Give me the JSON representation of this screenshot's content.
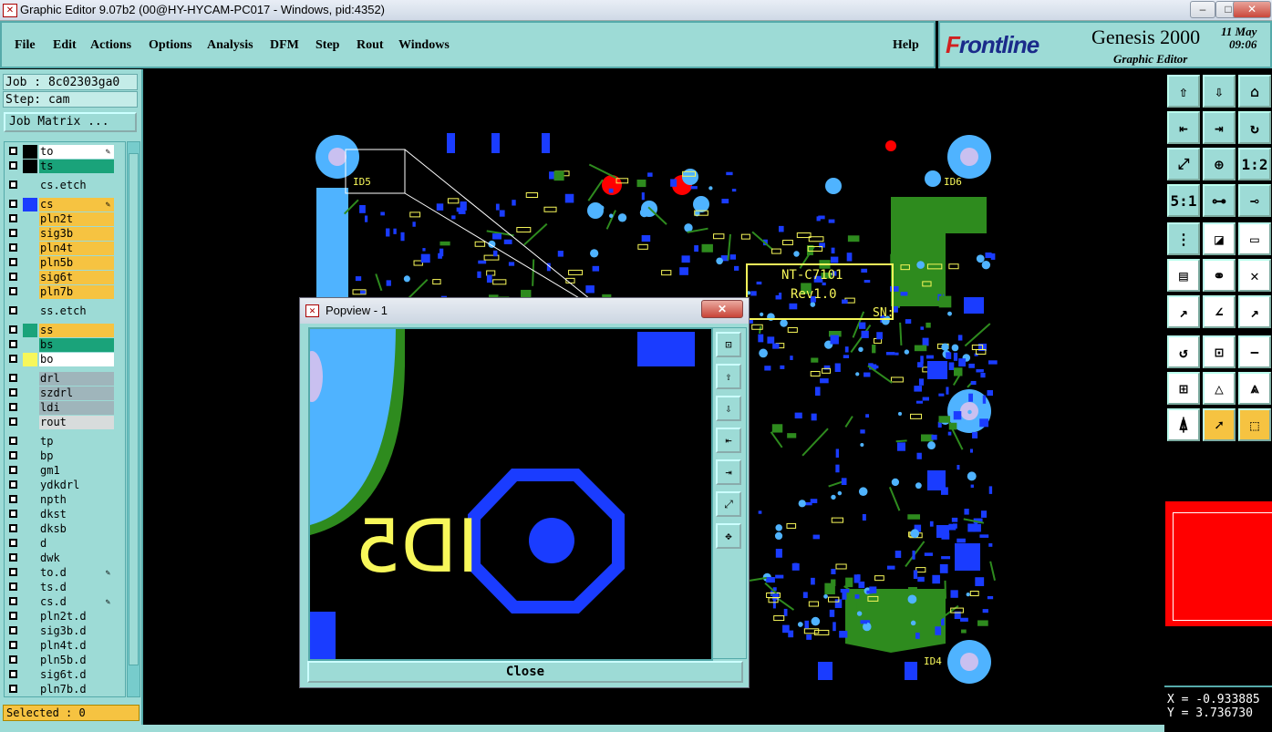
{
  "window": {
    "title": "Graphic Editor 9.07b2 (00@HY-HYCAM-PC017 - Windows, pid:4352)",
    "min": "–",
    "max": "□",
    "close": "✕"
  },
  "menubar": {
    "items": [
      "File",
      "Edit",
      "Actions",
      "Options",
      "Analysis",
      "DFM",
      "Step",
      "Rout",
      "Windows"
    ],
    "help": "Help"
  },
  "brand": {
    "logo_f": "F",
    "logo_rest": "rontline",
    "product": "Genesis 2000",
    "sub": "Graphic Editor",
    "date": "11 May",
    "time": "09:06"
  },
  "job": {
    "job_label": "Job : 8c02303ga0",
    "step_label": "Step: cam",
    "matrix_button": "Job Matrix ..."
  },
  "layers": [
    {
      "name": "to",
      "bg": "#ffffff",
      "swatch": "#000000",
      "edit": true
    },
    {
      "name": "ts",
      "bg": "#1aa37a",
      "swatch": "#000000",
      "edit": false
    },
    {
      "name": "cs.etch",
      "bg": "#9ddbd6",
      "swatch": "none",
      "edit": false
    },
    {
      "name": "cs",
      "bg": "#f6c341",
      "swatch": "#1a3cff",
      "edit": true
    },
    {
      "name": "pln2t",
      "bg": "#f6c341",
      "swatch": "none",
      "edit": false
    },
    {
      "name": "sig3b",
      "bg": "#f6c341",
      "swatch": "none",
      "edit": false
    },
    {
      "name": "pln4t",
      "bg": "#f6c341",
      "swatch": "none",
      "edit": false
    },
    {
      "name": "pln5b",
      "bg": "#f6c341",
      "swatch": "none",
      "edit": false
    },
    {
      "name": "sig6t",
      "bg": "#f6c341",
      "swatch": "none",
      "edit": false
    },
    {
      "name": "pln7b",
      "bg": "#f6c341",
      "swatch": "none",
      "edit": false
    },
    {
      "name": "ss.etch",
      "bg": "#9ddbd6",
      "swatch": "none",
      "edit": false
    },
    {
      "name": "ss",
      "bg": "#f6c341",
      "swatch": "#1aa37a",
      "edit": false
    },
    {
      "name": "bs",
      "bg": "#1aa37a",
      "swatch": "none",
      "edit": false
    },
    {
      "name": "bo",
      "bg": "#ffffff",
      "swatch": "#f7f75a",
      "edit": false
    },
    {
      "name": "drl",
      "bg": "#9fb5bb",
      "swatch": "none",
      "edit": false
    },
    {
      "name": "szdrl",
      "bg": "#9fb5bb",
      "swatch": "none",
      "edit": false
    },
    {
      "name": "ldi",
      "bg": "#9fb5bb",
      "swatch": "none",
      "edit": false
    },
    {
      "name": "rout",
      "bg": "#d8dcdc",
      "swatch": "none",
      "edit": false
    },
    {
      "name": "tp",
      "bg": "#9ddbd6",
      "swatch": "none",
      "edit": false
    },
    {
      "name": "bp",
      "bg": "#9ddbd6",
      "swatch": "none",
      "edit": false
    },
    {
      "name": "gm1",
      "bg": "#9ddbd6",
      "swatch": "none",
      "edit": false
    },
    {
      "name": "ydkdrl",
      "bg": "#9ddbd6",
      "swatch": "none",
      "edit": false
    },
    {
      "name": "npth",
      "bg": "#9ddbd6",
      "swatch": "none",
      "edit": false
    },
    {
      "name": "dkst",
      "bg": "#9ddbd6",
      "swatch": "none",
      "edit": false
    },
    {
      "name": "dksb",
      "bg": "#9ddbd6",
      "swatch": "none",
      "edit": false
    },
    {
      "name": "d",
      "bg": "#9ddbd6",
      "swatch": "none",
      "edit": false
    },
    {
      "name": "dwk",
      "bg": "#9ddbd6",
      "swatch": "none",
      "edit": false
    },
    {
      "name": "to.d",
      "bg": "#9ddbd6",
      "swatch": "none",
      "edit": true
    },
    {
      "name": "ts.d",
      "bg": "#9ddbd6",
      "swatch": "none",
      "edit": false
    },
    {
      "name": "cs.d",
      "bg": "#9ddbd6",
      "swatch": "none",
      "edit": true
    },
    {
      "name": "pln2t.d",
      "bg": "#9ddbd6",
      "swatch": "none",
      "edit": false
    },
    {
      "name": "sig3b.d",
      "bg": "#9ddbd6",
      "swatch": "none",
      "edit": false
    },
    {
      "name": "pln4t.d",
      "bg": "#9ddbd6",
      "swatch": "none",
      "edit": false
    },
    {
      "name": "pln5b.d",
      "bg": "#9ddbd6",
      "swatch": "none",
      "edit": false
    },
    {
      "name": "sig6t.d",
      "bg": "#9ddbd6",
      "swatch": "none",
      "edit": false
    },
    {
      "name": "pln7b.d",
      "bg": "#9ddbd6",
      "swatch": "none",
      "edit": false
    }
  ],
  "status": {
    "selected": "Selected : 0"
  },
  "board": {
    "silk_texts": [
      "NT-C7101",
      "Rev1.0",
      "SN:",
      "ID5",
      "ID6",
      "ID4"
    ]
  },
  "popview": {
    "title": "Popview - 1",
    "close_x": "✕",
    "close_button": "Close",
    "label": "ID5"
  },
  "coords": {
    "x": "X = -0.933885",
    "y": "Y = 3.736730"
  },
  "colors": {
    "teal": "#9ddbd6",
    "copper_blue": "#1a3cff",
    "pad_light_blue": "#4fb3ff",
    "solder_green": "#2e8b1e",
    "silk_yellow": "#f7f75a",
    "red": "#ff0000",
    "orange": "#f6c341"
  },
  "toolbar_icons": [
    "layer-up-icon",
    "layer-down-icon",
    "home-icon",
    "pan-left-icon",
    "pan-right-icon",
    "rotate-icon",
    "zoom-fit-icon",
    "zoom-icon",
    "one-to-one-icon",
    "five-to-one-icon",
    "measure-icon",
    "snap-icon",
    "net-icon",
    "draw-icon",
    "select-icon",
    "ruler-icon",
    "connect-icon",
    "cross-icon",
    "drag-icon",
    "line-icon",
    "arc-icon",
    "undo-icon",
    "feature-icon",
    "minus-icon",
    "resize-icon",
    "triangle-icon",
    "triangle-up-icon",
    "triangle-a-icon",
    "pointer-icon",
    "pointer-box-icon",
    "pointer-clock-icon"
  ],
  "toolbar_labels": {
    "one_to_one": "1:2",
    "five_to_one": "5:1"
  }
}
